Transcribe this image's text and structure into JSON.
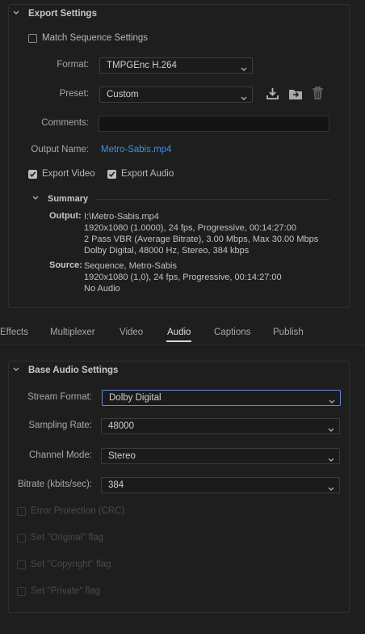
{
  "export_settings": {
    "title": "Export Settings",
    "match_sequence_label": "Match Sequence Settings",
    "match_sequence_checked": false,
    "format_label": "Format:",
    "format_value": "TMPGEnc H.264",
    "preset_label": "Preset:",
    "preset_value": "Custom",
    "comments_label": "Comments:",
    "comments_value": "",
    "output_name_label": "Output Name:",
    "output_name_value": "Metro-Sabis.mp4",
    "export_video_label": "Export Video",
    "export_video_checked": true,
    "export_audio_label": "Export Audio",
    "export_audio_checked": true
  },
  "summary": {
    "title": "Summary",
    "output_key": "Output:",
    "output_lines": [
      "I:\\Metro-Sabis.mp4",
      "1920x1080 (1.0000), 24 fps, Progressive, 00:14:27:00",
      "2 Pass VBR (Average Bitrate), 3.00 Mbps, Max 30.00 Mbps",
      "Dolby Digital, 48000 Hz, Stereo, 384 kbps"
    ],
    "source_key": "Source:",
    "source_lines": [
      "Sequence, Metro-Sabis",
      "1920x1080 (1,0), 24 fps, Progressive, 00:14:27:00",
      "No Audio"
    ]
  },
  "tabs": [
    {
      "label": "Effects",
      "active": false
    },
    {
      "label": "Multiplexer",
      "active": false
    },
    {
      "label": "Video",
      "active": false
    },
    {
      "label": "Audio",
      "active": true
    },
    {
      "label": "Captions",
      "active": false
    },
    {
      "label": "Publish",
      "active": false
    }
  ],
  "audio": {
    "title": "Base Audio Settings",
    "stream_format_label": "Stream Format:",
    "stream_format_value": "Dolby Digital",
    "sampling_rate_label": "Sampling Rate:",
    "sampling_rate_value": "48000",
    "channel_mode_label": "Channel Mode:",
    "channel_mode_value": "Stereo",
    "bitrate_label": "Bitrate (kbits/sec):",
    "bitrate_value": "384",
    "options": [
      {
        "label": "Error Protection (CRC)",
        "checked": false,
        "enabled": false
      },
      {
        "label": "Set \"Original\" flag",
        "checked": false,
        "enabled": false
      },
      {
        "label": "Set \"Copyright\" flag",
        "checked": false,
        "enabled": false
      },
      {
        "label": "Set \"Private\" flag",
        "checked": false,
        "enabled": false
      }
    ]
  },
  "icons": {
    "collapse": "chevron-down-icon",
    "dropdown": "chevron-down-icon",
    "save_preset": "download-icon",
    "import_preset": "folder-import-icon",
    "delete_preset": "trash-icon"
  },
  "colors": {
    "background": "#1e1e1e",
    "link": "#3f8fe6",
    "focus_border": "#5d8fd6",
    "active_tab_underline": "#d8d8d8"
  }
}
